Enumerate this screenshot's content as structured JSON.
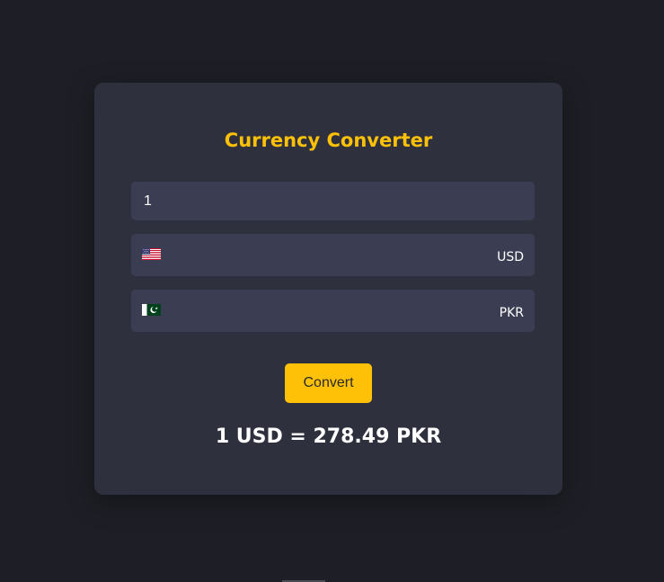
{
  "converter": {
    "title": "Currency Converter",
    "amount": "1",
    "from": {
      "code": "USD",
      "flag_icon": "us-flag-icon"
    },
    "to": {
      "code": "PKR",
      "flag_icon": "pk-flag-icon"
    },
    "convert_label": "Convert",
    "result": "1 USD = 278.49 PKR"
  },
  "colors": {
    "page_bg": "#1e1f26",
    "card_bg": "#2e303e",
    "field_bg": "#3b3d52",
    "accent": "#ffc107",
    "text": "#ffffff"
  }
}
